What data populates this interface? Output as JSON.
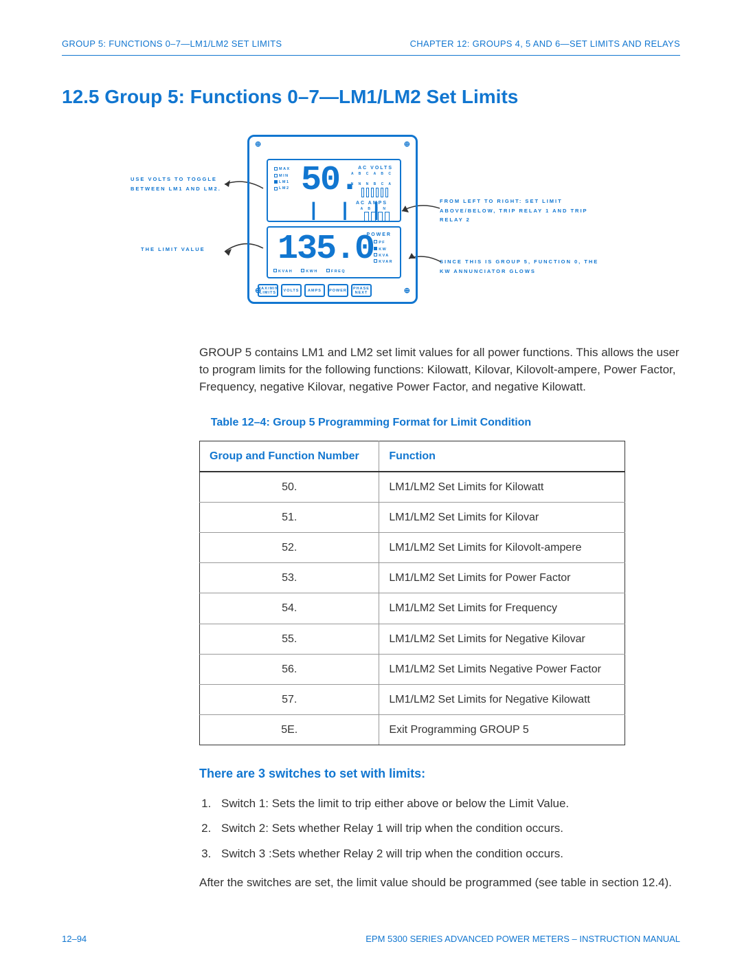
{
  "header": {
    "left": "GROUP 5: FUNCTIONS 0–7—LM1/LM2 SET LIMITS",
    "right": "CHAPTER 12: GROUPS 4, 5 AND 6—SET LIMITS AND RELAYS"
  },
  "section": {
    "title": "12.5 Group 5: Functions 0–7—LM1/LM2 Set Limits"
  },
  "meter": {
    "leds": {
      "max": "MAX",
      "min": "MIN",
      "lm1": "LM1",
      "lm2": "LM2"
    },
    "disp1": "50.",
    "disp2": "135.0",
    "ac_volts_label": "AC VOLTS",
    "ac_volts_sub1": "A B C A B C",
    "ac_volts_sub2": "N N N B C A",
    "ac_amps_label": "AC AMPS",
    "ac_amps_sub": "A B C N",
    "power_label": "POWER",
    "power_items": {
      "pf": "PF",
      "kw": "KW",
      "kva": "KVA",
      "kvar": "KVAR"
    },
    "bottom_labels": {
      "kvah": "KVAH",
      "kwh": "KWH",
      "freq": "FREQ"
    },
    "buttons": {
      "b1a": "MAX/MIN",
      "b1b": "LIMITS",
      "b2": "VOLTS",
      "b3": "AMPS",
      "b4": "POWER",
      "b5a": "PHASE",
      "b5b": "NEXT"
    }
  },
  "callouts": {
    "left1": "USE VOLTS TO TOGGLE BETWEEN LM1 AND LM2.",
    "left2": "THE LIMIT VALUE",
    "right1": "FROM LEFT TO RIGHT: SET LIMIT ABOVE/BELOW, TRIP RELAY 1 AND TRIP RELAY 2",
    "right2": "SINCE THIS IS GROUP 5, FUNCTION 0, THE KW ANNUNCIATOR GLOWS"
  },
  "intro": "GROUP 5 contains LM1 and LM2 set limit values for all power functions. This allows the user to program limits for the following functions: Kilowatt, Kilovar, Kilovolt-ampere, Power Factor, Frequency, negative Kilovar, negative Power Factor, and negative Kilowatt.",
  "table": {
    "caption": "Table 12–4: Group 5 Programming Format for Limit Condition",
    "headers": {
      "col1": "Group and Function Number",
      "col2": "Function"
    },
    "rows": [
      {
        "n": "50.",
        "f": "LM1/LM2 Set Limits for Kilowatt"
      },
      {
        "n": "51.",
        "f": "LM1/LM2 Set Limits for Kilovar"
      },
      {
        "n": "52.",
        "f": "LM1/LM2 Set Limits for Kilovolt-ampere"
      },
      {
        "n": "53.",
        "f": "LM1/LM2 Set Limits for Power Factor"
      },
      {
        "n": "54.",
        "f": "LM1/LM2 Set Limits for Frequency"
      },
      {
        "n": "55.",
        "f": "LM1/LM2 Set Limits for Negative Kilovar"
      },
      {
        "n": "56.",
        "f": "LM1/LM2 Set Limits Negative Power Factor"
      },
      {
        "n": "57.",
        "f": "LM1/LM2 Set Limits for Negative Kilowatt"
      },
      {
        "n": "5E.",
        "f": "Exit Programming GROUP 5"
      }
    ]
  },
  "sub_heading": "There are 3 switches to set with limits:",
  "switches": [
    "Switch 1: Sets the limit to trip either above or below the Limit Value.",
    "Switch 2: Sets whether Relay 1 will trip when the condition occurs.",
    "Switch 3 :Sets whether Relay 2 will trip when the condition occurs."
  ],
  "after": "After the switches are set, the limit value should be programmed (see table in section 12.4).",
  "footer": {
    "left": "12–94",
    "right": "EPM 5300 SERIES ADVANCED POWER METERS – INSTRUCTION MANUAL"
  }
}
